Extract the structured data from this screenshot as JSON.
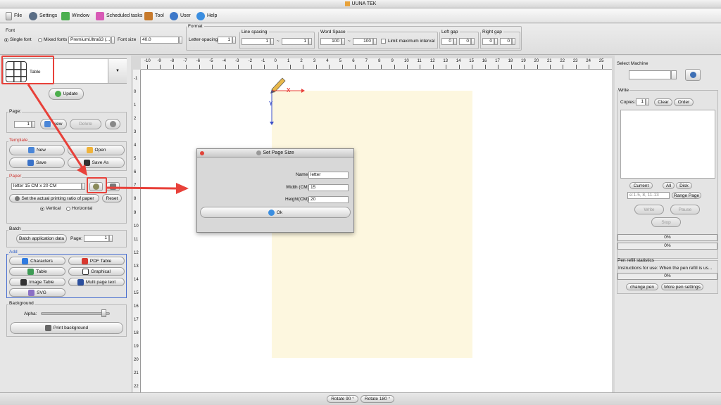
{
  "app": {
    "title": "UUNA TEK"
  },
  "menu": [
    "File",
    "Settings",
    "Window",
    "Scheduled tasks",
    "Tool",
    "User",
    "Help"
  ],
  "font": {
    "legend": "Font",
    "single": "Single font",
    "mixed": "Mixed fonts",
    "font_value": "PremiumUltra63 (...",
    "size_label": "Font size",
    "size_value": "40.0"
  },
  "format": {
    "legend": "Format",
    "letter_spacing_label": "Letter-spacing",
    "letter_spacing": "1",
    "line_spacing_legend": "Line spacing",
    "line_from": "1",
    "tilde": "~",
    "line_to": "1",
    "word_space_legend": "Word Space",
    "word_from": "100",
    "word_to": "100",
    "limit_label": "Limit maximum interval",
    "left_gap_legend": "Left gap",
    "left_gap": [
      "0",
      "0"
    ],
    "right_gap_legend": "Right gap",
    "right_gap": [
      "0",
      "0"
    ]
  },
  "left": {
    "template_name": "Table",
    "update": "Update",
    "page_label": "Page:",
    "page_value": "1",
    "new": "New",
    "delete": "Delete",
    "template_title": "Template",
    "tpl_new": "New",
    "tpl_open": "Open",
    "tpl_save": "Save",
    "tpl_saveas": "Save As",
    "paper_title": "Paper",
    "paper_value": "letter 15 CM x 20 CM",
    "ratio": "Set the actual printing ratio of paper",
    "reset": "Reset",
    "vertical": "Vertical",
    "horizontal": "Horizontal",
    "batch_title": "Batch",
    "batch_btn": "Batch application data",
    "batch_page_label": "Page:",
    "batch_page": "1",
    "add_title": "Add",
    "characters": "Characters",
    "pdf_table": "PDF Table",
    "table": "Table",
    "graphical": "Graphical",
    "image_table": "Image Table",
    "multi_page": "Multi page text",
    "svg": "SVG",
    "bg_title": "Background",
    "alpha": "Alpha:",
    "print_bg": "Print background",
    "alpha_level": 0.95
  },
  "ruler": {
    "h": [
      "-10",
      "-9",
      "-8",
      "-7",
      "-6",
      "-5",
      "-4",
      "-3",
      "-2",
      "-1",
      "0",
      "1",
      "2",
      "3",
      "4",
      "5",
      "6",
      "7",
      "8",
      "9",
      "10",
      "11",
      "12",
      "13",
      "14",
      "15",
      "16",
      "17",
      "18",
      "19",
      "20",
      "21",
      "22",
      "23",
      "24",
      "25"
    ],
    "v": [
      "-1",
      "0",
      "1",
      "2",
      "3",
      "4",
      "5",
      "6",
      "7",
      "8",
      "9",
      "10",
      "11",
      "12",
      "13",
      "14",
      "15",
      "16",
      "17",
      "18",
      "19",
      "20",
      "21",
      "22"
    ]
  },
  "axes": {
    "x": "X",
    "y": "Y"
  },
  "dialog": {
    "title": "Set Page Size",
    "name_label": "Name",
    "name": "letter",
    "width_label": "Width (CM)",
    "width": "15",
    "height_label": "Height(CM)",
    "height": "20",
    "ok": "Ok"
  },
  "right": {
    "select_machine": "Select Machine",
    "write": "Write",
    "copies_label": "Copies:",
    "copies": "1",
    "clear": "Clear",
    "order": "Order",
    "current": "Current",
    "all": "All",
    "disk": "Disk",
    "range_placeholder": "e:1-5, 8, 11-13",
    "range_page": "Range Page",
    "write_btn": "Write",
    "pause": "Pause",
    "stop": "Stop",
    "progress1": "0%",
    "progress2": "0%",
    "refill_title": "Pen refill statistics",
    "refill_text": "Instructions for use: When the pen refill is us...",
    "progress3": "0%",
    "change_pen": "change pen",
    "more_pen": "More pen settings"
  },
  "bottom": {
    "rotate90": "Rotate 90 °",
    "rotate180": "Rotate 180 °"
  },
  "colors": {
    "annotation": "#e8413a",
    "paper": "#fdf7df",
    "accent": "#2f6fd6"
  }
}
